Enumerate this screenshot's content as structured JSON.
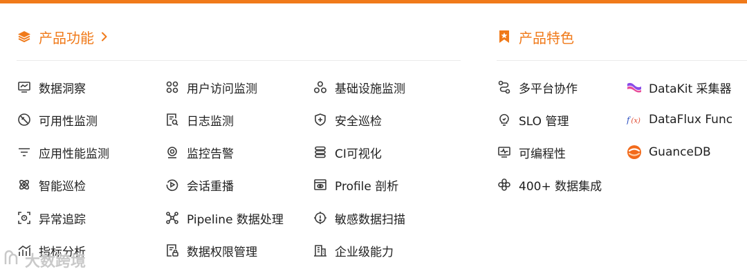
{
  "features": {
    "title": "产品功能",
    "items": [
      {
        "label": "数据洞察",
        "icon": "monitor-chart-icon"
      },
      {
        "label": "用户访问监测",
        "icon": "grid-circles-icon"
      },
      {
        "label": "基础设施监测",
        "icon": "three-circles-icon"
      },
      {
        "label": "可用性监测",
        "icon": "circle-slash-icon"
      },
      {
        "label": "日志监测",
        "icon": "document-search-icon"
      },
      {
        "label": "安全巡检",
        "icon": "shield-icon"
      },
      {
        "label": "应用性能监测",
        "icon": "filter-lines-icon"
      },
      {
        "label": "监控告警",
        "icon": "camera-alarm-icon"
      },
      {
        "label": "CI可视化",
        "icon": "server-stack-icon"
      },
      {
        "label": "智能巡检",
        "icon": "atom-icon"
      },
      {
        "label": "会话重播",
        "icon": "replay-icon"
      },
      {
        "label": "Profile 剖析",
        "icon": "browser-eye-icon"
      },
      {
        "label": "异常追踪",
        "icon": "focus-target-icon"
      },
      {
        "label": "Pipeline 数据处理",
        "icon": "nodes-network-icon"
      },
      {
        "label": "敏感数据扫描",
        "icon": "warning-scan-icon"
      },
      {
        "label": "指标分析",
        "icon": "bar-trend-icon"
      },
      {
        "label": "数据权限管理",
        "icon": "document-lock-icon"
      },
      {
        "label": "企业级能力",
        "icon": "building-icon"
      }
    ]
  },
  "highlights": {
    "title": "产品特色",
    "items": [
      {
        "label": "多平台协作",
        "icon": "workflow-icon"
      },
      {
        "label": "DataKit 采集器",
        "icon": "datakit-logo-icon"
      },
      {
        "label": "SLO 管理",
        "icon": "lightbulb-icon"
      },
      {
        "label": "DataFlux Func",
        "icon": "func-logo-icon"
      },
      {
        "label": "可编程性",
        "icon": "code-monitor-icon"
      },
      {
        "label": "GuanceDB",
        "icon": "guancedb-logo-icon"
      },
      {
        "label": "400+ 数据集成",
        "icon": "integration-icon"
      }
    ]
  },
  "watermark": {
    "text": "大数跨境"
  },
  "colors": {
    "accent": "#f07a1a",
    "text": "#1f1f1f",
    "icon": "#3a3a3a",
    "divider": "#ebebeb"
  }
}
